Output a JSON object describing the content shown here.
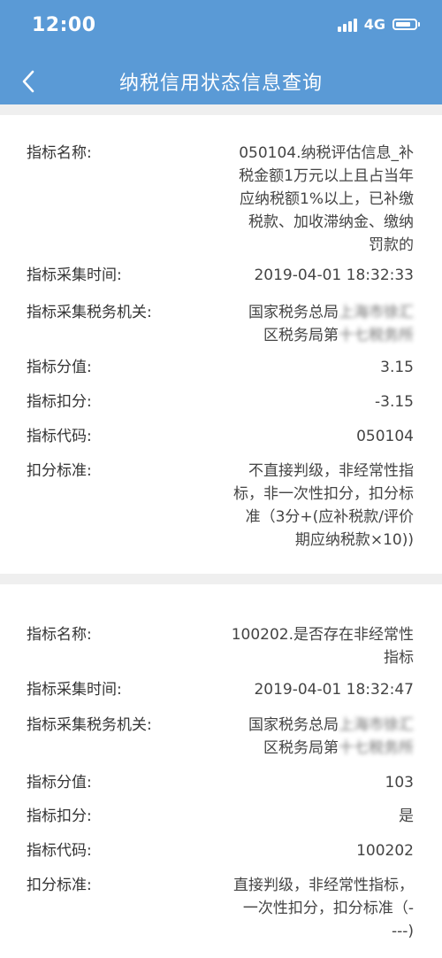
{
  "status": {
    "time": "12:00",
    "network": "4G"
  },
  "nav": {
    "back_icon": "chevron-left-icon",
    "title": "纳税信用状态信息查询"
  },
  "colors": {
    "header": "#5a9ad6",
    "divider": "#efefef"
  },
  "labels": {
    "name": "指标名称:",
    "time": "指标采集时间:",
    "office": "指标采集税务机关:",
    "score": "指标分值:",
    "deduct": "指标扣分:",
    "code": "指标代码:",
    "standard": "扣分标准:"
  },
  "records": [
    {
      "name": [
        "050104.纳税评估信息_补",
        "税金额1万元以上且占当年",
        "应纳税额1%以上，已补缴",
        "税款、加收滞纳金、缴纳",
        "罚款的"
      ],
      "time": "2019-04-01 18:32:33",
      "office_a": "国家税务总局",
      "office_b": "上海市徐汇",
      "office_c": "区税务局第",
      "office_d": "十七税务所",
      "score": "3.15",
      "deduct": "-3.15",
      "code": "050104",
      "standard": [
        "不直接判级，非经常性指",
        "标，非一次性扣分，扣分标",
        "准（3分+(应补税款/评价",
        "期应纳税款×10))"
      ]
    },
    {
      "name": [
        "100202.是否存在非经常性",
        "指标"
      ],
      "time": "2019-04-01 18:32:47",
      "office_a": "国家税务总局",
      "office_b": "上海市徐汇",
      "office_c": "区税务局第",
      "office_d": "十七税务所",
      "score": "103",
      "deduct": "是",
      "code": "100202",
      "standard": [
        "直接判级，非经常性指标，",
        "一次性扣分，扣分标准（-",
        "---)"
      ]
    }
  ]
}
